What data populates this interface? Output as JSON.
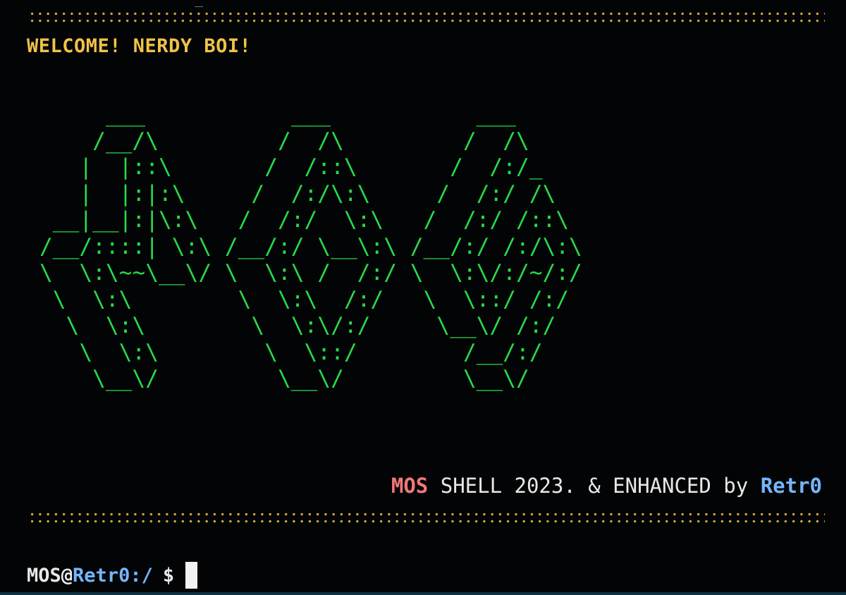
{
  "terminal": {
    "top_edge_glyph": "_",
    "welcome": "WELCOME! NERDY BOI!",
    "ascii_art": "     ___           ___           ___    \n    /__/\\         /  /\\         /  /\\   \n   |  |::\\       /  /::\\       /  /:/_  \n   |  |:|:\\     /  /:/\\:\\     /  /:/ /\\ \n __|__|:|\\:\\   /  /:/  \\:\\   /  /:/ /::\\\n/__/::::| \\:\\ /__/:/ \\__\\:\\ /__/:/ /:/\\:\\\n\\  \\:\\~~\\__\\/ \\  \\:\\ /  /:/ \\  \\:\\/:/~/:/\n \\  \\:\\        \\  \\:\\  /:/   \\  \\::/ /:/ \n  \\  \\:\\        \\  \\:\\/:/     \\__\\/ /:/  \n   \\  \\:\\        \\  \\::/        /__/:/   \n    \\__\\/         \\__\\/         \\__\\/    ",
    "credits": {
      "brand": "MOS",
      "text": " SHELL 2023. & ENHANCED by ",
      "author": "Retr0"
    },
    "prompt": {
      "user": "MOS",
      "at": "@",
      "host": "Retr0",
      "separator": ":",
      "path": "/",
      "symbol": "$"
    }
  },
  "colors": {
    "background": "#030405",
    "accent_yellow": "#f0c24a",
    "art_green": "#27d94a",
    "brand_red": "#f07878",
    "author_blue": "#74b6ff",
    "text_white": "#e8e8e8"
  }
}
